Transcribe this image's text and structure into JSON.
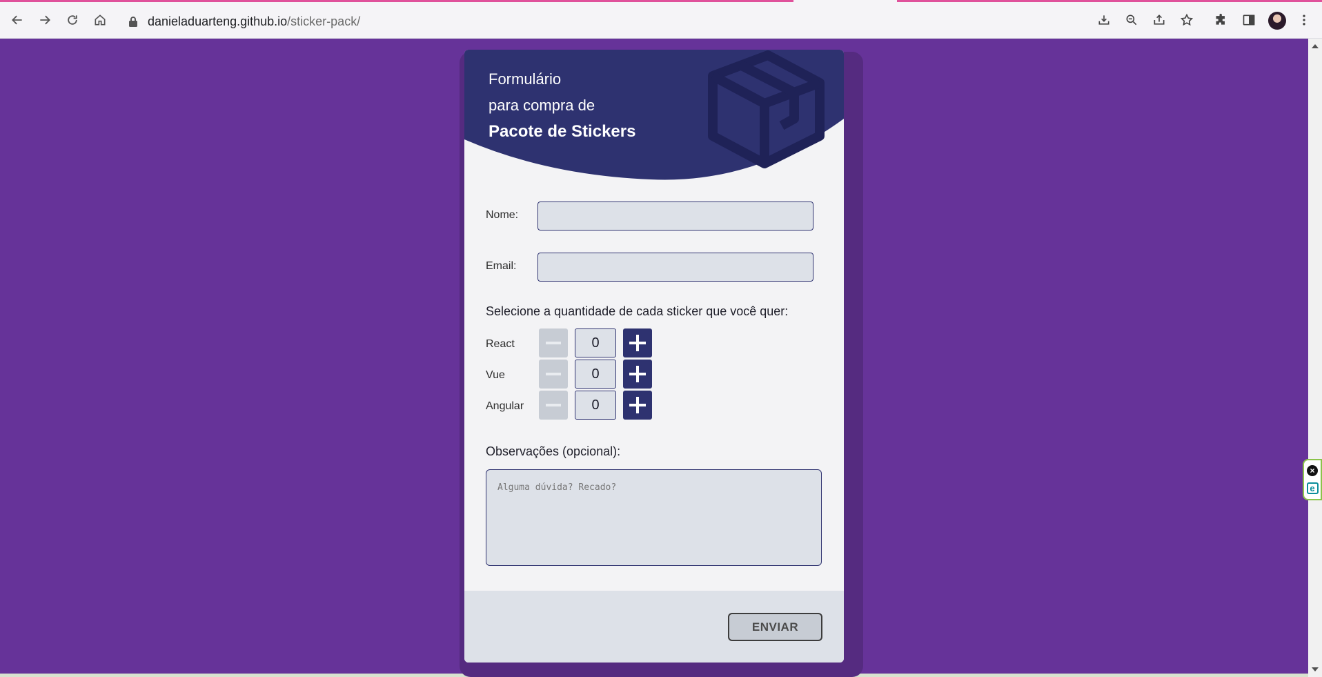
{
  "browser": {
    "url_host": "danieladuarteng.github.io",
    "url_path": "/sticker-pack/"
  },
  "form": {
    "title_line1": "Formulário",
    "title_line2": "para compra de",
    "title_line3": "Pacote de Stickers",
    "name_label": "Nome:",
    "name_value": "",
    "email_label": "Email:",
    "email_value": "",
    "stickers_title": "Selecione a quantidade de cada sticker que você quer:",
    "stickers": [
      {
        "label": "React",
        "quantity": "0"
      },
      {
        "label": "Vue",
        "quantity": "0"
      },
      {
        "label": "Angular",
        "quantity": "0"
      }
    ],
    "notes_label": "Observações (opcional):",
    "notes_placeholder": "Alguma dúvida? Recado?",
    "submit_label": "ENVIAR"
  },
  "colors": {
    "page_background": "#663399",
    "header_background": "#2e3270",
    "accent": "#2e3270",
    "disabled": "#c7ccd4"
  },
  "icons": [
    "back-arrow-icon",
    "forward-arrow-icon",
    "reload-icon",
    "home-icon",
    "lock-icon",
    "download-icon",
    "zoom-out-icon",
    "share-icon",
    "star-icon",
    "puzzle-icon",
    "side-panel-icon",
    "kebab-menu-icon",
    "box-icon",
    "minus-icon",
    "plus-icon"
  ]
}
